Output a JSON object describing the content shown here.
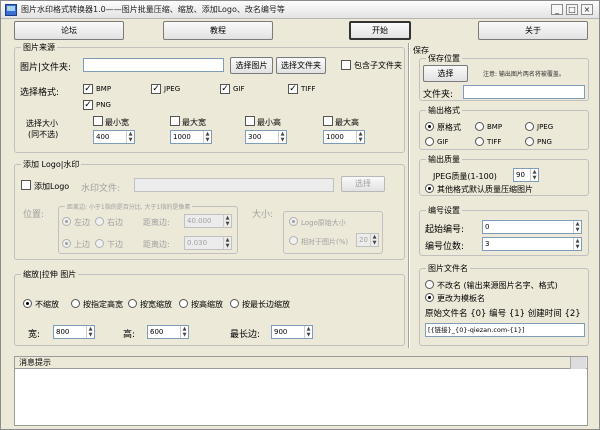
{
  "window": {
    "title": "图片水印格式转换器1.0——图片批量压缩、缩放、添加Logo、改名编号等",
    "min": "_",
    "max": "□",
    "close": "×"
  },
  "toolbar": {
    "forum": "论坛",
    "tutorial": "教程",
    "start": "开始",
    "about": "关于"
  },
  "source": {
    "caption": "图片来源",
    "path_label": "图片|文件夹:",
    "path_value": "",
    "select_image": "选择图片",
    "select_folder": "选择文件夹",
    "include_sub": "包含子文件夹",
    "format_label": "选择格式:",
    "formats": [
      {
        "name": "BMP",
        "checked": true
      },
      {
        "name": "JPEG",
        "checked": true
      },
      {
        "name": "GIF",
        "checked": true
      },
      {
        "name": "TIFF",
        "checked": true
      },
      {
        "name": "PNG",
        "checked": true
      }
    ],
    "size_label_1": "选择大小",
    "size_label_2": "(同不选)",
    "min_width": {
      "label": "最小宽",
      "value": "400"
    },
    "max_width": {
      "label": "最大宽",
      "value": "1000"
    },
    "min_height": {
      "label": "最小高",
      "value": "300"
    },
    "max_height": {
      "label": "最大高",
      "value": "1000"
    }
  },
  "logo": {
    "caption": "添加 Logo|水印",
    "add_label": "添加Logo",
    "file_label": "水印文件:",
    "file_value": "",
    "select": "选择",
    "position_label": "位置:",
    "pos_caption": "距离边: 小于1指的是百分比, 大于1指的是像素",
    "left": "左边",
    "right": "右边",
    "top": "上边",
    "bottom": "下边",
    "dist_h_label": "距离边:",
    "dist_h_value": "40.000",
    "dist_v_label": "距离边:",
    "dist_v_value": "0.030",
    "size_label": "大小:",
    "orig_size": "Logo原始大小",
    "relative": "相对于图片(%)",
    "relative_value": "20"
  },
  "scale": {
    "caption": "缩放|拉伸 图片",
    "options": [
      {
        "label": "不缩放",
        "on": true
      },
      {
        "label": "按指定高宽",
        "on": false
      },
      {
        "label": "按宽缩放",
        "on": false
      },
      {
        "label": "按高缩放",
        "on": false
      },
      {
        "label": "按最长边缩放",
        "on": false
      }
    ],
    "width_label": "宽:",
    "width_value": "800",
    "height_label": "高:",
    "height_value": "600",
    "longest_label": "最长边:",
    "longest_value": "900"
  },
  "save": {
    "caption": "保存",
    "location_caption": "保存位置",
    "choose": "选择",
    "note": "注意: 输出图片两名将被覆盖。",
    "folder_label": "文件夹:",
    "folder_value": ""
  },
  "out_format": {
    "caption": "输出格式",
    "options": [
      {
        "label": "原格式",
        "on": true
      },
      {
        "label": "BMP",
        "on": false
      },
      {
        "label": "JPEG",
        "on": false
      },
      {
        "label": "GIF",
        "on": false
      },
      {
        "label": "TIFF",
        "on": false
      },
      {
        "label": "PNG",
        "on": false
      }
    ]
  },
  "quality": {
    "caption": "输出质量",
    "jpeg_label": "JPEG质量(1-100)",
    "jpeg_value": "90",
    "other": "其他格式默认质量压缩图片"
  },
  "numbering": {
    "caption": "编号设置",
    "start_label": "起始编号:",
    "start_value": "0",
    "digits_label": "编号位数:",
    "digits_value": "3"
  },
  "filename": {
    "caption": "图片文件名",
    "no_rename": "不改名 (输出来源图片名字、格式)",
    "rename": "更改为模板名",
    "tokens": "原始文件名 {0}  编号 {1}  创建时间 {2}",
    "template": "[{链接}_{0}-qiezan.com-{1}]"
  },
  "message": {
    "caption": "消息提示"
  }
}
